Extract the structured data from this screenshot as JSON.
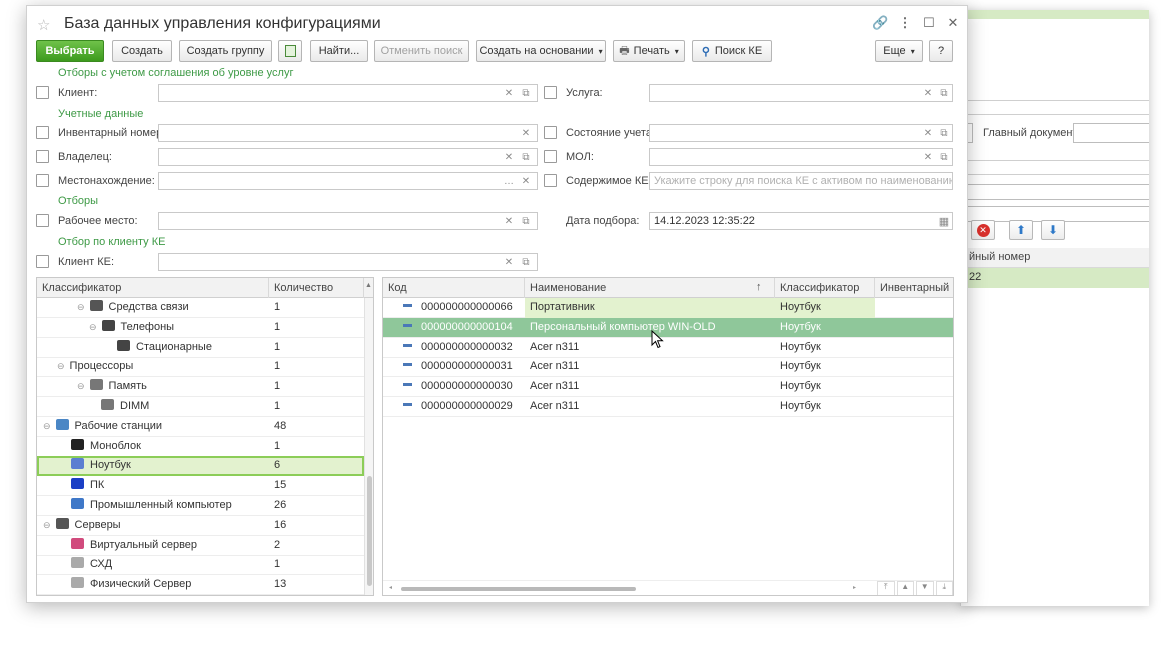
{
  "window": {
    "title": "База данных управления конфигурациями"
  },
  "toolbar": {
    "select": "Выбрать",
    "create": "Создать",
    "create_group": "Создать группу",
    "find": "Найти...",
    "cancel_search": "Отменить поиск",
    "create_based_on": "Создать на основании",
    "print": "Печать",
    "search_ke": "Поиск КЕ",
    "more": "Еще",
    "help": "?"
  },
  "filters": {
    "group_sla": "Отборы с учетом соглашения об уровне услуг",
    "client": "Клиент:",
    "service": "Услуга:",
    "group_account": "Учетные данные",
    "inventory_number": "Инвентарный номер:",
    "account_state": "Состояние учета:",
    "owner": "Владелец:",
    "mol": "МОЛ:",
    "location": "Местонахождение:",
    "ke_content": "Содержимое КЕ:",
    "ke_content_placeholder": "Укажите строку для поиска КЕ с активом по наименованию или...",
    "group_filters": "Отборы",
    "workplace": "Рабочее место:",
    "selection_date": "Дата подбора:",
    "selection_date_value": "14.12.2023 12:35:22",
    "group_client_ke": "Отбор по клиенту КЕ",
    "client_ke": "Клиент КЕ:"
  },
  "tree": {
    "headers": [
      "Классификатор",
      "Количество"
    ],
    "rows": [
      {
        "name": "Средства связи",
        "count": "1"
      },
      {
        "name": "Телефоны",
        "count": "1"
      },
      {
        "name": "Стационарные",
        "count": "1"
      },
      {
        "name": "Процессоры",
        "count": "1"
      },
      {
        "name": "Память",
        "count": "1"
      },
      {
        "name": "DIMM",
        "count": "1"
      },
      {
        "name": "Рабочие станции",
        "count": "48"
      },
      {
        "name": "Моноблок",
        "count": "1"
      },
      {
        "name": "Ноутбук",
        "count": "6"
      },
      {
        "name": "ПК",
        "count": "15"
      },
      {
        "name": "Промышленный компьютер",
        "count": "26"
      },
      {
        "name": "Серверы",
        "count": "16"
      },
      {
        "name": "Виртуальный сервер",
        "count": "2"
      },
      {
        "name": "СХД",
        "count": "1"
      },
      {
        "name": "Физический Сервер",
        "count": "13"
      }
    ]
  },
  "list": {
    "headers": [
      "Код",
      "Наименование",
      "Классификатор",
      "Инвентарный номер"
    ],
    "rows": [
      {
        "code": "000000000000066",
        "name": "Портативник",
        "class": "Ноутбук"
      },
      {
        "code": "000000000000104",
        "name": "Персональный компьютер WIN-OLD",
        "class": "Ноутбук"
      },
      {
        "code": "000000000000032",
        "name": "Acer n311",
        "class": "Ноутбук"
      },
      {
        "code": "000000000000031",
        "name": "Acer n311",
        "class": "Ноутбук"
      },
      {
        "code": "000000000000030",
        "name": "Acer n311",
        "class": "Ноутбук"
      },
      {
        "code": "000000000000029",
        "name": "Acer n311",
        "class": "Ноутбук"
      }
    ]
  },
  "background": {
    "main_document": "Главный документ:",
    "col_header": "йный номер",
    "row_value": "22"
  },
  "colors": {
    "accent_green": "#3e9a46",
    "selected_row": "#8fc79a",
    "highlight_row": "#e3f2cf"
  }
}
